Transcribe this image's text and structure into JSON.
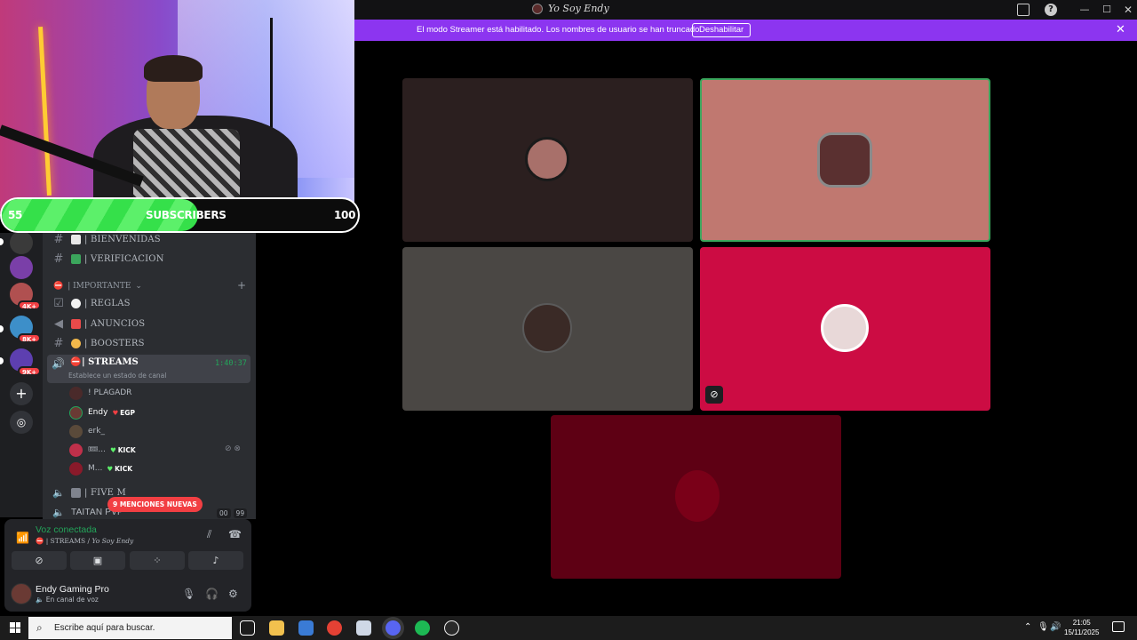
{
  "window": {
    "title": "Yo Soy Endy"
  },
  "banner": {
    "message": "El modo Streamer está habilitado. Los nombres de usuario se han truncado.",
    "button": "Deshabilitar"
  },
  "overlay": {
    "subscribers_current": "55",
    "subscribers_label": "SUBSCRIBERS",
    "subscribers_goal": "100",
    "progress_fraction": 0.55
  },
  "server_rail": {
    "badges": [
      "4K+",
      "8K+",
      "9K+"
    ]
  },
  "channels": {
    "top": [
      {
        "name": "| BIENVENIDAS"
      },
      {
        "name": "| VERIFICACION"
      }
    ],
    "category": "| IMPORTANTE",
    "list": [
      {
        "name": "| REGLAS"
      },
      {
        "name": "| ANUNCIOS"
      },
      {
        "name": "| BOOSTERS"
      }
    ],
    "active_voice": {
      "name": "| STREAMS",
      "time": "1:40:37",
      "status": "Establece un estado de canal"
    },
    "voice_users": [
      {
        "name": "! PLAGADR",
        "tag": ""
      },
      {
        "name": "Endy",
        "tag": "EGP"
      },
      {
        "name": "erk_",
        "tag": ""
      },
      {
        "name": "🎟...",
        "tag": "KICK"
      },
      {
        "name": "M...",
        "tag": "KICK"
      }
    ],
    "more": [
      {
        "name": "| FIVE M"
      },
      {
        "name": "TAITAN PVP"
      }
    ],
    "mentions": "9 MENCIONES NUEVAS",
    "taitan_counts": [
      "00",
      "99"
    ]
  },
  "voice_panel": {
    "status": "Voz conectada",
    "channel": "| STREAMS / ",
    "server": "Yo Soy Endy",
    "user_name": "Endy Gaming Pro",
    "user_status": "En canal de voz"
  },
  "taskbar": {
    "search_placeholder": "Escribe aquí para buscar.",
    "time": "21:05",
    "date": "15/11/2025"
  },
  "colors": {
    "banner": "#8c35f0",
    "voice_green": "#23a55a",
    "mention_red": "#f23f43"
  }
}
